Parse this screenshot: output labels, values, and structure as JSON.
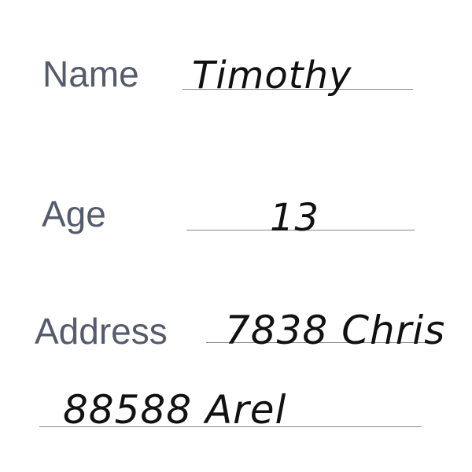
{
  "form": {
    "name": {
      "label": "Name",
      "value": "Timothy"
    },
    "age": {
      "label": "Age",
      "value": "13"
    },
    "address": {
      "label": "Address",
      "line1": "7838 Chris",
      "line2": "88588 Arel"
    }
  }
}
